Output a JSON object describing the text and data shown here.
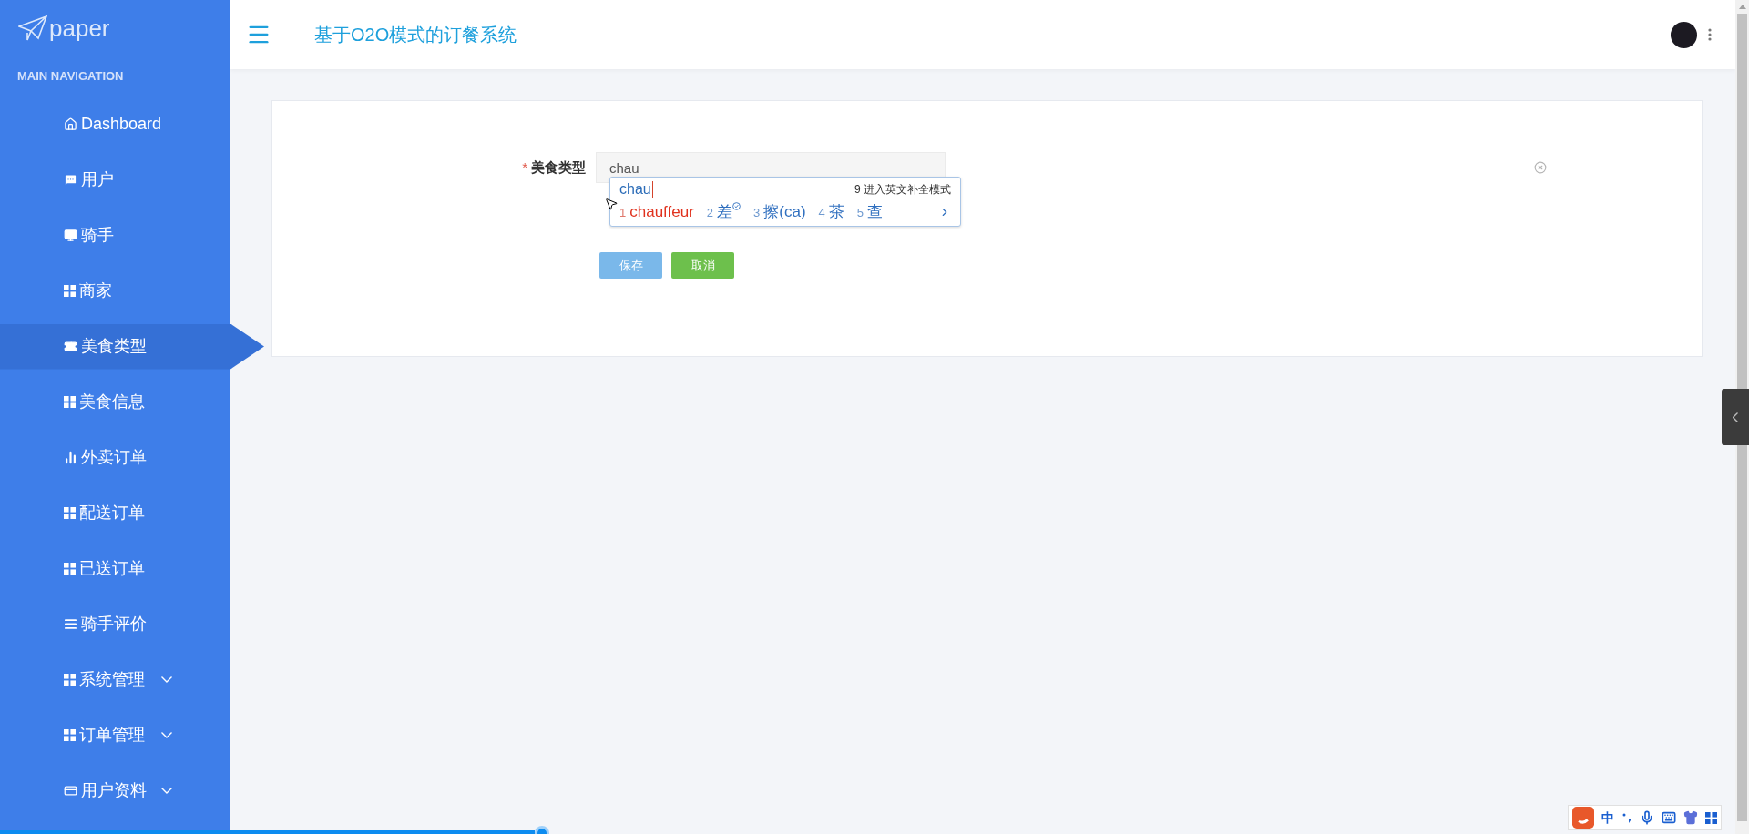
{
  "logo": {
    "text": "paper"
  },
  "sidebar": {
    "heading": "MAIN NAVIGATION",
    "items": [
      {
        "label": "Dashboard",
        "kind": "home",
        "selected": false,
        "expandable": false
      },
      {
        "label": "用户",
        "kind": "chat",
        "selected": false,
        "expandable": false
      },
      {
        "label": "骑手",
        "kind": "monitor",
        "selected": false,
        "expandable": false
      },
      {
        "label": "商家",
        "kind": "grid",
        "selected": false,
        "expandable": false
      },
      {
        "label": "美食类型",
        "kind": "ticket",
        "selected": true,
        "expandable": false
      },
      {
        "label": "美食信息",
        "kind": "grid",
        "selected": false,
        "expandable": false
      },
      {
        "label": "外卖订单",
        "kind": "bars",
        "selected": false,
        "expandable": false
      },
      {
        "label": "配送订单",
        "kind": "grid",
        "selected": false,
        "expandable": false
      },
      {
        "label": "已送订单",
        "kind": "grid",
        "selected": false,
        "expandable": false
      },
      {
        "label": "骑手评价",
        "kind": "list",
        "selected": false,
        "expandable": false
      },
      {
        "label": "系统管理",
        "kind": "grid",
        "selected": false,
        "expandable": true
      },
      {
        "label": "订单管理",
        "kind": "grid",
        "selected": false,
        "expandable": true
      },
      {
        "label": "用户资料",
        "kind": "card",
        "selected": false,
        "expandable": true
      }
    ]
  },
  "header": {
    "title": "基于O2O模式的订餐系统"
  },
  "form": {
    "fields": [
      {
        "label": "美食类型",
        "required_mark": "*",
        "value": "chau"
      }
    ],
    "buttons": [
      {
        "label": "保存",
        "kind": "primary"
      },
      {
        "label": "取消",
        "kind": "cancel"
      }
    ]
  },
  "ime": {
    "composition": "chau",
    "hint": "9 进入英文补全模式",
    "candidates": [
      {
        "index": "1",
        "text": "chauffeur",
        "selected": true,
        "checkmark": false
      },
      {
        "index": "2",
        "text": "差",
        "selected": false,
        "checkmark": true
      },
      {
        "index": "3",
        "text": "擦(ca)",
        "selected": false,
        "checkmark": false
      },
      {
        "index": "4",
        "text": "茶",
        "selected": false,
        "checkmark": false
      },
      {
        "index": "5",
        "text": "查",
        "selected": false,
        "checkmark": false
      }
    ]
  },
  "ime_toolbar": {
    "mode": "中"
  },
  "video_progress": {
    "level": 0.31
  }
}
